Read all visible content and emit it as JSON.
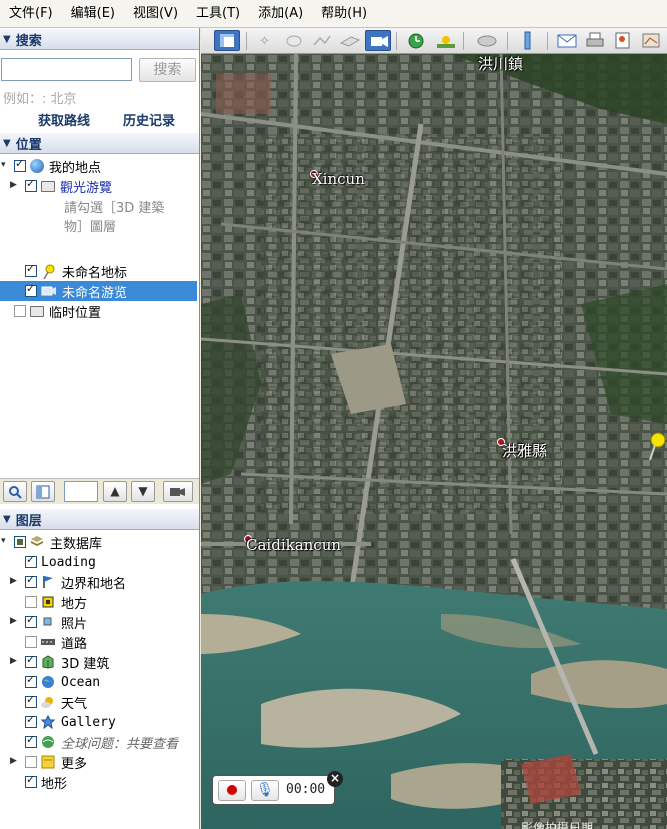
{
  "menubar": {
    "items": [
      "文件(F)",
      "编辑(E)",
      "视图(V)",
      "工具(T)",
      "添加(A)",
      "帮助(H)"
    ]
  },
  "search": {
    "header": "搜索",
    "input_value": "",
    "button_label": "搜索",
    "example": "例如：: 北京",
    "get_route": "获取路线",
    "history": "历史记录"
  },
  "places": {
    "header": "位置",
    "items": [
      {
        "label": "我的地点",
        "checked": true,
        "icon": "globe-icon"
      },
      {
        "label": "觀光游覽",
        "checked": true,
        "icon": "folder-icon"
      },
      {
        "label": "請勾選［3D 建築物］圖層",
        "note": true
      },
      {
        "label": "未命名地标",
        "checked": true,
        "icon": "pushpin-icon"
      },
      {
        "label": "未命名游览",
        "checked": true,
        "icon": "tour-icon",
        "selected": true
      },
      {
        "label": "临时位置",
        "checked": false,
        "icon": "folder-icon"
      }
    ],
    "note_line1": "請勾選［3D 建築",
    "note_line2": "物］圖層"
  },
  "layers": {
    "header": "图层",
    "items": [
      {
        "label": "主数据库",
        "icon": "database-icon"
      },
      {
        "label": "Loading",
        "checked": true
      },
      {
        "label": "边界和地名",
        "checked": true,
        "icon": "flag-icon"
      },
      {
        "label": "地方",
        "checked": false,
        "icon": "square-icon"
      },
      {
        "label": "照片",
        "checked": true,
        "icon": "photo-icon"
      },
      {
        "label": "道路",
        "checked": false,
        "icon": "road-icon"
      },
      {
        "label": "3D 建筑",
        "checked": true,
        "icon": "building-icon"
      },
      {
        "label": "Ocean",
        "checked": true,
        "icon": "ocean-icon"
      },
      {
        "label": "天气",
        "checked": true,
        "icon": "weather-icon"
      },
      {
        "label": "Gallery",
        "checked": true,
        "icon": "star-icon"
      },
      {
        "label": "全球问题：共要查看",
        "checked": true,
        "icon": "globe-icon"
      },
      {
        "label": "更多",
        "checked": false,
        "icon": "note-icon"
      },
      {
        "label": "地形",
        "checked": true
      }
    ]
  },
  "map": {
    "labels": [
      {
        "text": "洪川鎮"
      },
      {
        "text": "Xincun"
      },
      {
        "text": "洪雅縣"
      },
      {
        "text": "Caidikancun"
      }
    ],
    "timer": "00:00",
    "close": "×",
    "date_text": "影像拍摄日期"
  },
  "colors": {
    "selection": "#3b8ad8",
    "header_text": "#1b3a6b",
    "active_tool": "#3e74c1"
  }
}
